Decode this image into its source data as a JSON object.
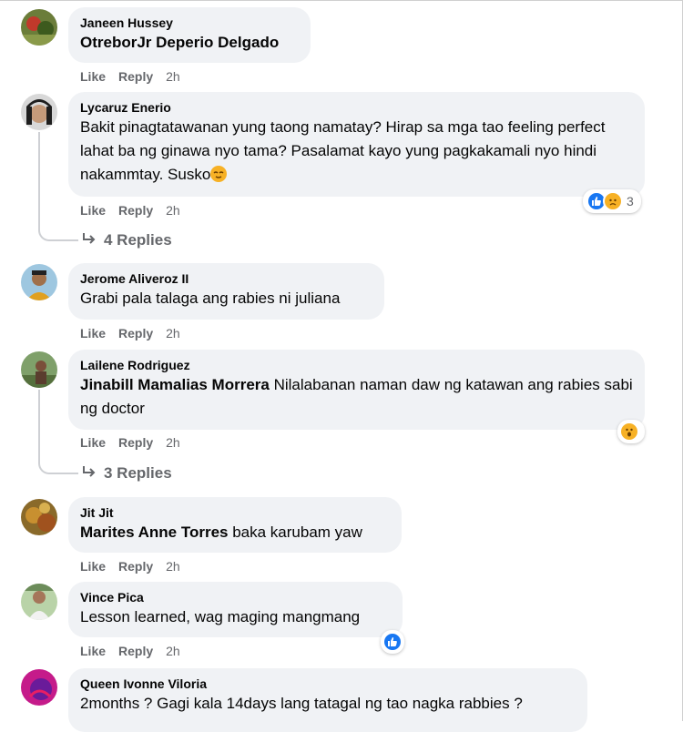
{
  "actions": {
    "like": "Like",
    "reply": "Reply"
  },
  "comments": [
    {
      "author": "Janeen Hussey",
      "tag": "OtreborJr Deperio Delgado",
      "text": "",
      "time": "2h"
    },
    {
      "author": "Lycaruz Enerio",
      "tag": "",
      "text": "Bakit pinagtatawanan yung taong namatay? Hirap sa mga tao feeling perfect lahat ba ng ginawa nyo tama? Pasalamat kayo yung pagkakamali nyo hindi nakammtay. Susko",
      "time": "2h",
      "reaction_count": "3",
      "reactions": [
        "like-icon",
        "sad-icon"
      ],
      "replies": "4 Replies"
    },
    {
      "author": "Jerome Aliveroz II",
      "tag": "",
      "text": "Grabi pala talaga ang rabies ni juliana",
      "time": "2h"
    },
    {
      "author": "Lailene Rodriguez",
      "tag": "Jinabill Mamalias Morrera",
      "text": " Nilalabanan naman daw ng katawan ang rabies sabi ng doctor",
      "time": "2h",
      "reactions": [
        "wow-icon"
      ],
      "replies": "3 Replies"
    },
    {
      "author": "Jit Jit",
      "tag": "Marites Anne Torres",
      "text": " baka karubam yaw",
      "time": "2h"
    },
    {
      "author": "Vince Pica",
      "tag": "",
      "text": "Lesson learned, wag maging mangmang",
      "time": "2h",
      "reactions": [
        "like-icon"
      ]
    },
    {
      "author": "Queen Ivonne Viloria",
      "tag": "",
      "text": "2months ? Gagi kala 14days lang tatagal ng tao nagka rabbies ?",
      "time": ""
    }
  ],
  "colors": {
    "bubble": "#f0f2f5",
    "secondary_text": "#65676b",
    "like_blue": "#1877f2",
    "emoji_yellow": "#f7b125"
  }
}
